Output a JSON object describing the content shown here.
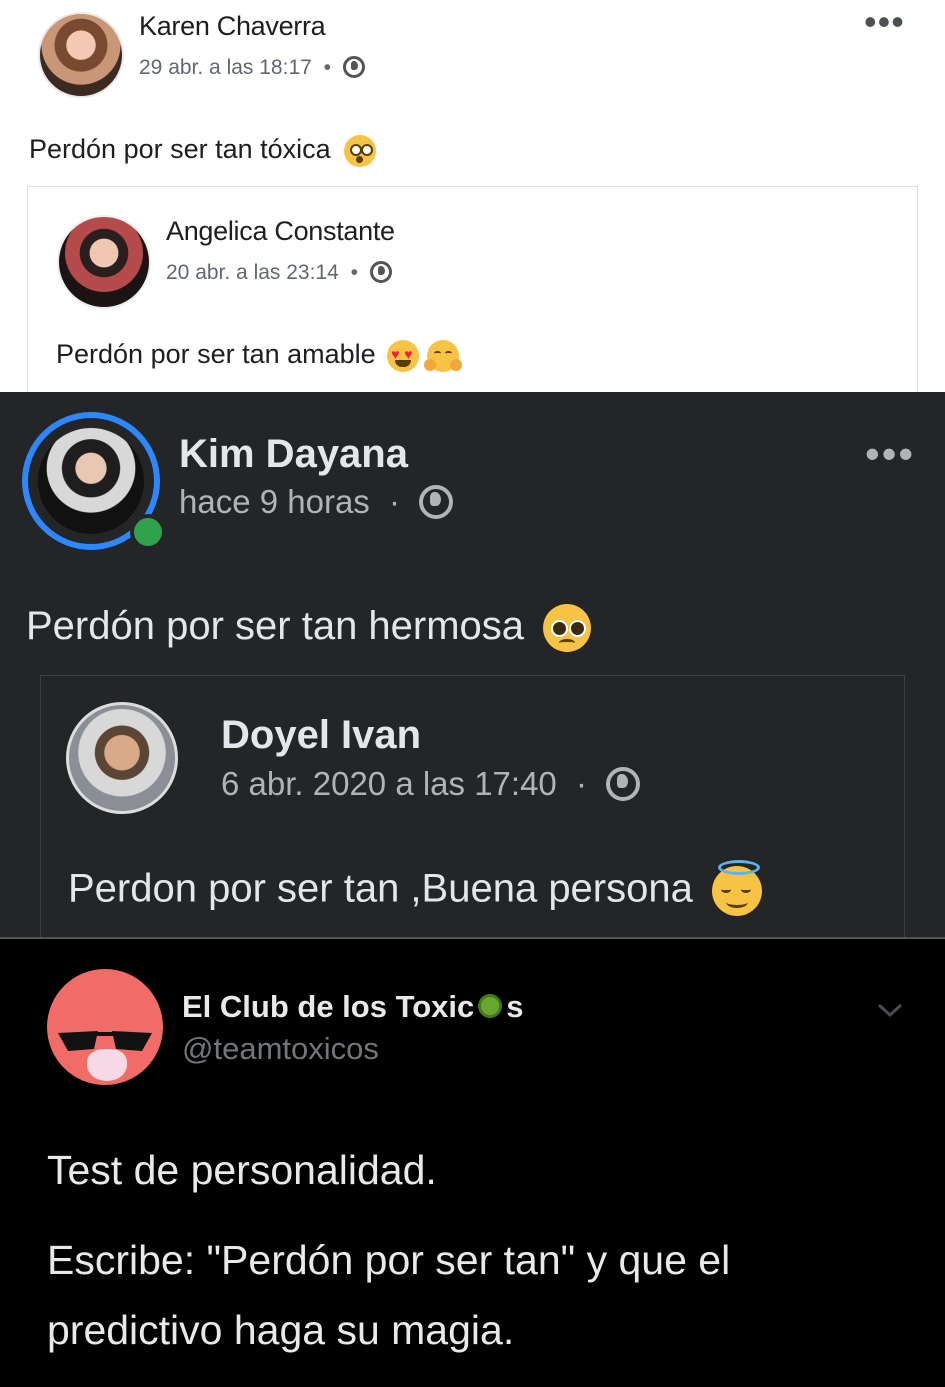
{
  "post1": {
    "author": "Karen Chaverra",
    "timestamp": "29 abr. a las 18:17",
    "separator": "•",
    "text": "Perdón por ser tan tóxica",
    "emoji": "astonished-face",
    "menu_icon": "more-dots-icon",
    "shared": {
      "author": "Angelica Constante",
      "timestamp": "20 abr. a las 23:14",
      "separator": "•",
      "text": "Perdón por ser tan amable",
      "emojis": [
        "heart-eyes-face",
        "hugging-face"
      ]
    }
  },
  "post2": {
    "author": "Kim Dayana",
    "timestamp": "hace 9 horas",
    "separator": "·",
    "text": "Perdón por ser tan hermosa",
    "emoji": "pleading-face",
    "online": true,
    "shared": {
      "author": "Doyel Ivan",
      "timestamp": "6 abr. 2020 a las 17:40",
      "separator": "·",
      "text": "Perdon por ser tan ,Buena persona",
      "emoji": "smiling-halo-face"
    }
  },
  "tweet": {
    "name_prefix": "El Club de los Toxic",
    "name_suffix": "s",
    "name_emoji": "virus-icon",
    "handle": "@teamtoxicos",
    "line1": "Test de personalidad.",
    "line2": "Escribe: \"Perdón por ser tan\" y que el",
    "line3": "predictivo haga su magia."
  },
  "colors": {
    "fb_dark_bg": "#242526",
    "twitter_bg": "#000000",
    "online_green": "#31a24c",
    "story_ring": "#2d88ff"
  }
}
